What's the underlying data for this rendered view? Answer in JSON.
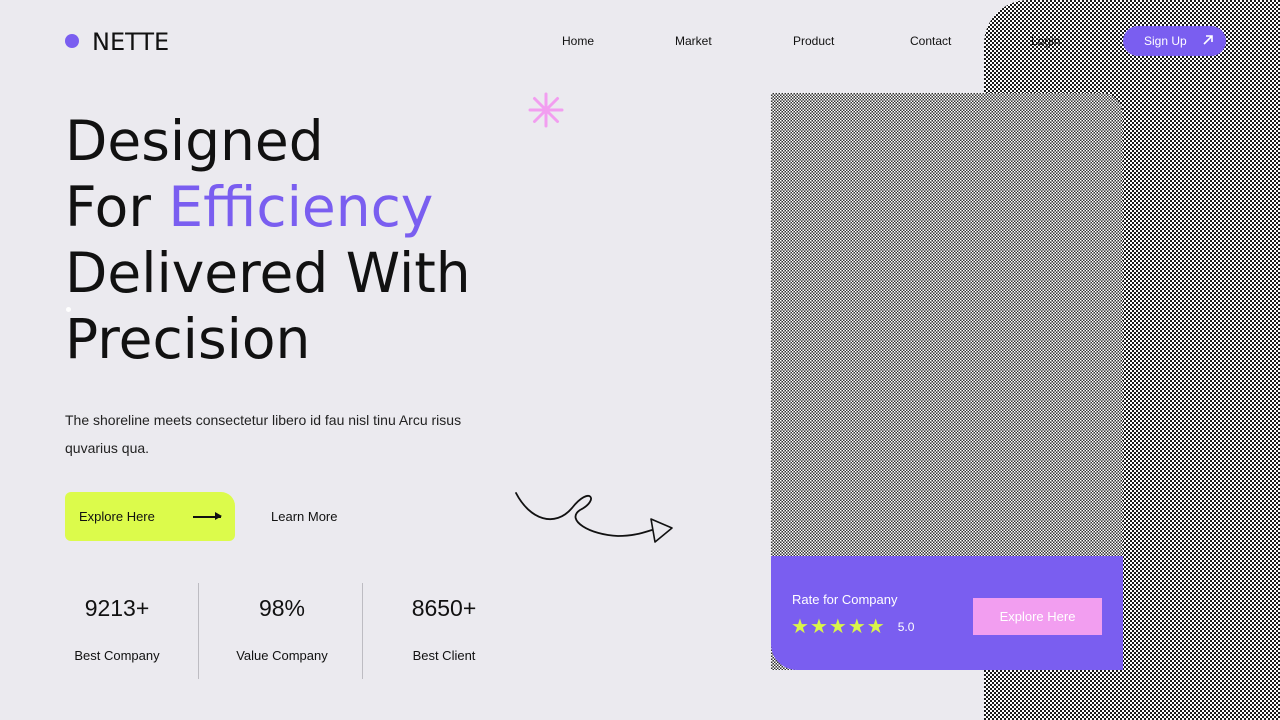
{
  "brand": {
    "name": "NETTE",
    "accent": "#7a5ef0"
  },
  "nav": {
    "items": [
      "Home",
      "Market",
      "Product",
      "Contact",
      "Login"
    ],
    "signup_label": "Sign Up",
    "signup_icon": "arrow-up-right-icon"
  },
  "hero": {
    "line1": "Designed",
    "line2_a": "For ",
    "line2_b": "Efficiency",
    "line3": "Delivered With",
    "line4": "Precision",
    "description": "The shoreline meets consectetur libero id fau nisl tinu Arcu risus quvarius qua."
  },
  "cta": {
    "primary_label": "Explore Here",
    "secondary_label": "Learn More",
    "primary_color": "#dcfb4b"
  },
  "stats": [
    {
      "value": "9213+",
      "label": "Best Company"
    },
    {
      "value": "98%",
      "label": "Value Company"
    },
    {
      "value": "8650+",
      "label": "Best Client"
    }
  ],
  "card": {
    "rate_label": "Rate for Company",
    "stars": 5,
    "rating": "5.0",
    "button_label": "Explore Here",
    "button_color": "#f29ef0"
  }
}
